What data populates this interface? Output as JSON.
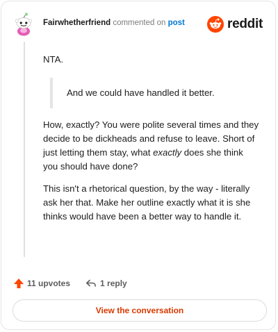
{
  "header": {
    "username": "Fairwhetherfriend",
    "action_text": " commented on ",
    "post_link": "post",
    "logo_text": "reddit"
  },
  "comment": {
    "line1": "NTA.",
    "quote": "And we could have handled it better.",
    "para1_a": "How, exactly? You were polite several times and they decide to be dickheads and refuse to leave. Short of just letting them stay, what ",
    "para1_em": "exactly",
    "para1_b": " does she think you should have done?",
    "para2": "This isn't a rhetorical question, by the way - literally ask her that. Make her outline exactly what it is she thinks would have been a better way to handle it."
  },
  "footer": {
    "upvotes": "11 upvotes",
    "replies": "1 reply"
  },
  "cta": {
    "label": "View the conversation"
  },
  "colors": {
    "brand": "#ff4500",
    "link": "#0079d3",
    "cta_text": "#d93900"
  }
}
